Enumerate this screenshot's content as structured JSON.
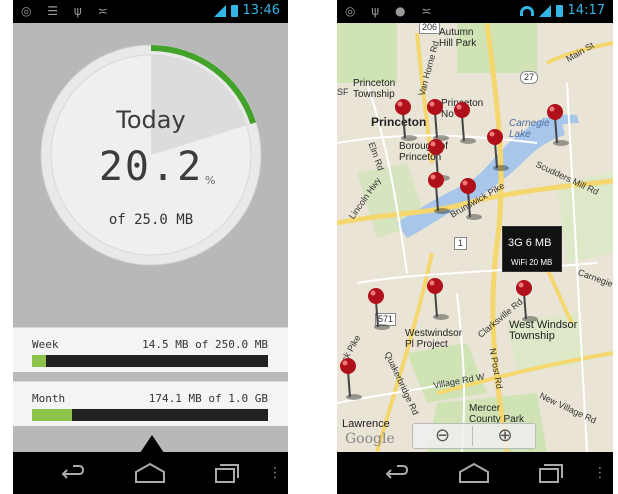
{
  "left_phone": {
    "status": {
      "time": "13:46"
    },
    "gauge": {
      "label": "Today",
      "value": "20.2",
      "unit": "%",
      "subtitle": "of 25.0 MB",
      "progress_fraction": 0.202,
      "accent_color": "#43a22a"
    },
    "week": {
      "name": "Week",
      "usage": "14.5 MB of 250.0 MB",
      "progress_fraction": 0.058
    },
    "month": {
      "name": "Month",
      "usage": "174.1 MB of 1.0 GB",
      "progress_fraction": 0.17
    },
    "bar_color": "#8bc34a"
  },
  "right_phone": {
    "status": {
      "time": "14:17"
    },
    "tooltip": {
      "primary": "3G 6 MB",
      "secondary": "WiFi 20 MB"
    },
    "zoom": {
      "out_symbol": "⊖",
      "in_symbol": "⊕"
    },
    "map_labels": {
      "autumn_hill_park": "Autumn\nHill Park",
      "main_st": "Main St",
      "princeton_township": "Princeton\nTownship",
      "princeton": "Princeton",
      "princeton_north": "Princeton\nNo",
      "van_horne": "Van Horne Rd",
      "carnegie_lake": "Carnegie\nLake",
      "borough": "Borough of\nPrinceton",
      "elm_rd": "Elm Rd",
      "lincoln_hwy": "Lincoln Hwy",
      "scudders_mill": "Scudders Mill Rd",
      "brunswick_pike": "Brunswick Pike",
      "carnegie_rd": "Carnegie",
      "westwindsor_pl": "Westwindsor\nPl Project",
      "clarksville": "Clarksville Rd",
      "west_windsor": "West Windsor\nTownship",
      "quakerbridge": "Quakerbridge Rd",
      "n_post_rd": "N Post Rd",
      "village_rd": "Village Rd W",
      "mercer": "Mercer\nCounty Park",
      "new_village": "New Village Rd",
      "lawrence": "Lawrence",
      "google": "Google",
      "route_206": "206",
      "route_27": "27",
      "route_1": "1",
      "route_571": "571",
      "pike": "ck Pike",
      "route_sf": "SF"
    }
  },
  "nav": {
    "back": "back",
    "home": "home",
    "recent": "recent-apps",
    "menu": "⋮"
  }
}
